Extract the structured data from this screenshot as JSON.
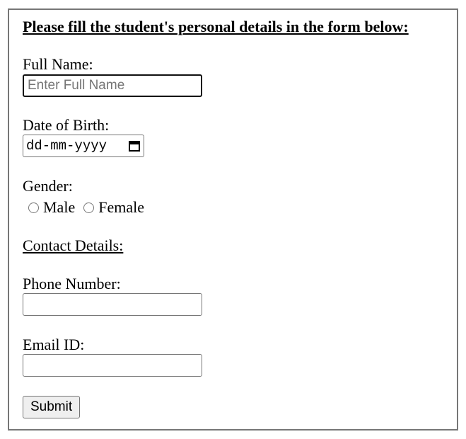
{
  "form": {
    "heading": "Please fill the student's personal details in the form below:",
    "full_name": {
      "label": "Full Name:",
      "placeholder": "Enter Full Name",
      "value": ""
    },
    "dob": {
      "label": "Date of Birth:",
      "placeholder": "dd-mm-yyyy",
      "icon": "calendar-icon"
    },
    "gender": {
      "label": "Gender:",
      "options": [
        "Male",
        "Female"
      ]
    },
    "contact_heading": "Contact Details:",
    "phone": {
      "label": "Phone Number:",
      "value": ""
    },
    "email": {
      "label": "Email ID:",
      "value": ""
    },
    "submit_label": "Submit"
  }
}
